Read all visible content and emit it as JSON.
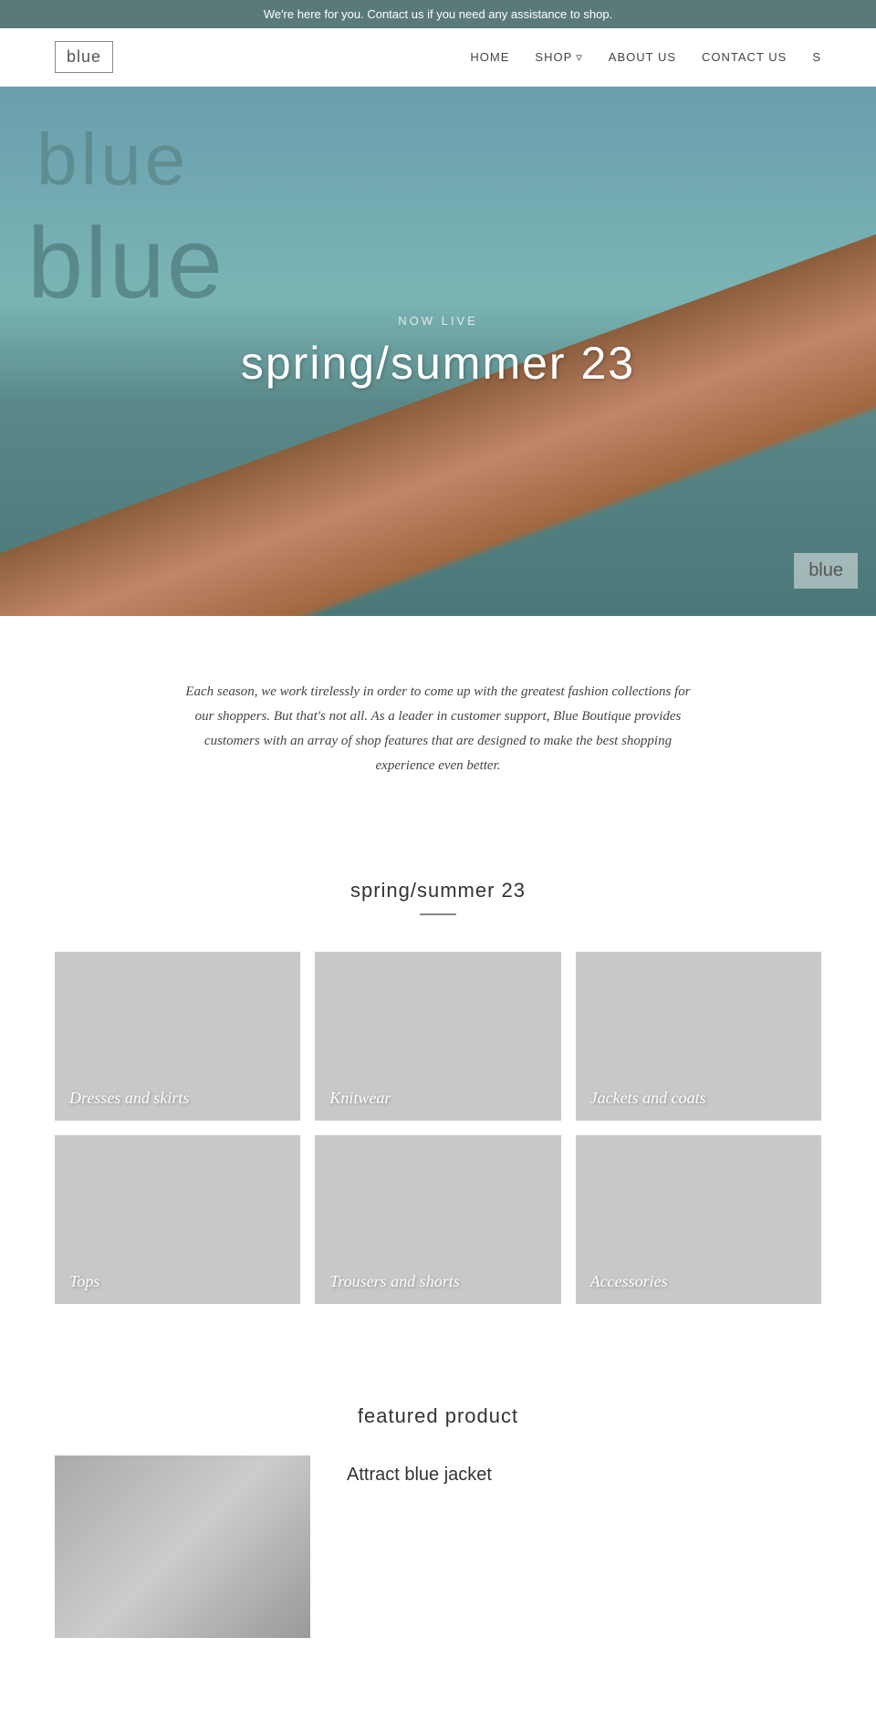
{
  "banner": {
    "text": "We're here for you. Contact us if you need any assistance to shop."
  },
  "header": {
    "logo": "blue",
    "nav": {
      "home": "HOME",
      "shop": "SHOP",
      "about": "ABOUT US",
      "contact": "CONTACT US",
      "search": "S"
    }
  },
  "hero": {
    "now_live": "NOW LIVE",
    "title": "spring/summer 23",
    "store_name": "blue",
    "corner_logo": "blue"
  },
  "description": {
    "text": "Each season, we work tirelessly in order to come up with the greatest fashion collections for our shoppers. But that's not all. As a leader in customer support, Blue Boutique provides customers with an array of shop features that are designed to make the best shopping experience even better."
  },
  "collections": {
    "title": "spring/summer 23",
    "items": [
      {
        "label": "Dresses and skirts"
      },
      {
        "label": "Knitwear"
      },
      {
        "label": "Jackets and coats"
      },
      {
        "label": "Tops"
      },
      {
        "label": "Trousers and shorts"
      },
      {
        "label": "Accessories"
      }
    ]
  },
  "featured": {
    "title": "featured product",
    "product_name": "Attract blue jacket"
  }
}
